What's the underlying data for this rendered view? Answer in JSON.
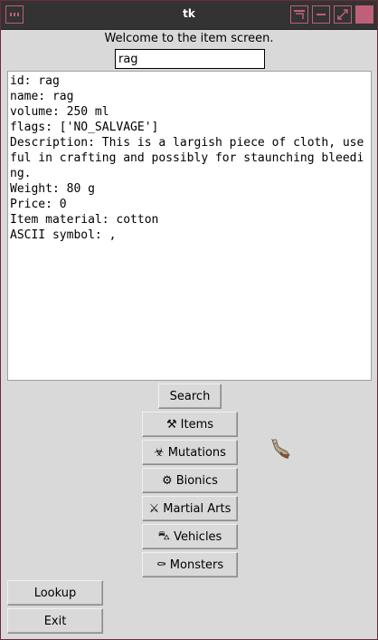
{
  "window": {
    "title": "tk"
  },
  "header": {
    "welcome": "Welcome to the item screen."
  },
  "search": {
    "value": "rag"
  },
  "output_lines": [
    "id: rag",
    "name: rag",
    "volume: 250 ml",
    "flags: ['NO_SALVAGE']",
    "Description: This is a largish piece of cloth, use",
    "ful in crafting and possibly for staunching bleedi",
    "ng.",
    "Weight: 80 g",
    "Price: 0",
    "Item material: cotton",
    "ASCII symbol: ,"
  ],
  "buttons": {
    "search": "Search",
    "items": {
      "icon": "⚒",
      "label": "Items"
    },
    "mutations": {
      "icon": "☣",
      "label": "Mutations"
    },
    "bionics": {
      "icon": "⚙",
      "label": "Bionics"
    },
    "martial_arts": {
      "icon": "⚔",
      "label": "Martial Arts"
    },
    "vehicles": {
      "icon": "⛍",
      "label": "Vehicles"
    },
    "monsters": {
      "icon": "⚰",
      "label": "Monsters"
    },
    "lookup": "Lookup",
    "exit": "Exit"
  },
  "sprite": {
    "icon": "creature-sprite-icon"
  },
  "colors": {
    "titlebar": "#333333",
    "accent": "#c06078",
    "window_bg": "#d9d9d9"
  }
}
